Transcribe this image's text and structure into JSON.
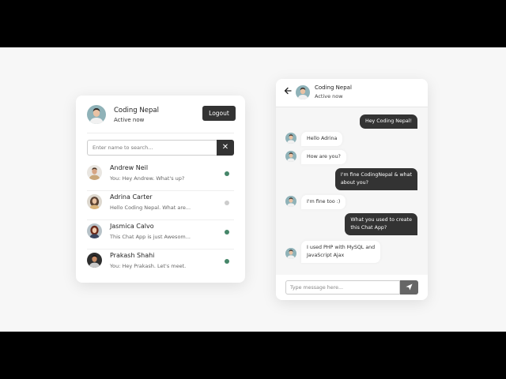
{
  "users_panel": {
    "current_user": {
      "name": "Coding Nepal",
      "status": "Active now"
    },
    "logout_label": "Logout",
    "search_placeholder": "Enter name to search...",
    "users": [
      {
        "name": "Andrew Neil",
        "last_message": "You: Hey Andrew. What's up?",
        "online": true
      },
      {
        "name": "Adrina Carter",
        "last_message": "Hello Coding Nepal. What are...",
        "online": false
      },
      {
        "name": "Jasmica Calvo",
        "last_message": "This Chat App is just Awesom...",
        "online": true
      },
      {
        "name": "Prakash Shahi",
        "last_message": "You: Hey Prakash. Let's meet.",
        "online": true
      }
    ]
  },
  "chat_panel": {
    "contact": {
      "name": "Coding Nepal",
      "status": "Active now"
    },
    "messages": [
      {
        "direction": "outgoing",
        "text": "Hey Coding Nepal!"
      },
      {
        "direction": "incoming",
        "text": "Hello Adrina"
      },
      {
        "direction": "incoming",
        "text": "How are you?"
      },
      {
        "direction": "outgoing",
        "text": "I'm fine CodingNepal & what\nabout you?"
      },
      {
        "direction": "incoming",
        "text": "I'm fine too :)"
      },
      {
        "direction": "outgoing",
        "text": "What you used to create\nthis Chat App?"
      },
      {
        "direction": "incoming",
        "text": "I used PHP with MySQL and\nJavaScript Ajax"
      }
    ],
    "input_placeholder": "Type message here..."
  },
  "colors": {
    "dark": "#333333",
    "online": "#468669",
    "offline": "#cccccc",
    "send_button": "#666666"
  },
  "icons": {
    "search_button": "close-icon",
    "back": "arrow-left-icon",
    "send": "paper-plane-icon"
  }
}
